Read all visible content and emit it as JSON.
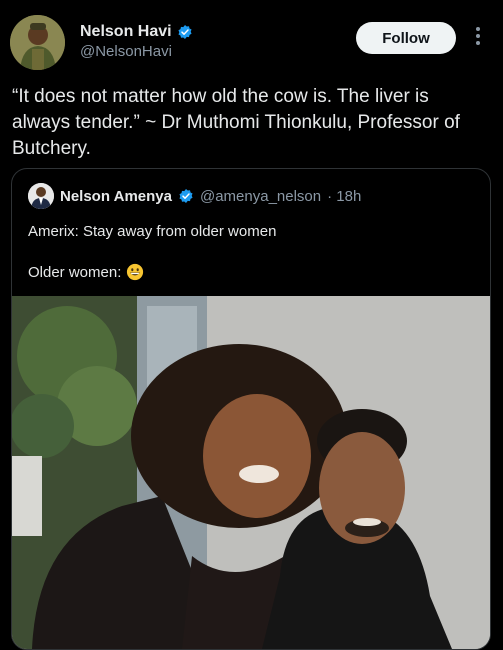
{
  "author": {
    "name": "Nelson Havi",
    "handle": "@NelsonHavi",
    "verified": true,
    "avatar_icon": "person-portrait-avatar"
  },
  "actions": {
    "follow_label": "Follow",
    "more_icon": "vertical-ellipsis-icon"
  },
  "tweet": {
    "text": "“It does not matter how old the cow is. The liver is always tender.” ~ Dr Muthomi Thionkulu, Professor of Butchery."
  },
  "quoted_tweet": {
    "author_name": "Nelson Amenya",
    "author_handle": "@amenya_nelson",
    "time": "· 18h",
    "verified": true,
    "line1": "Amerix: Stay away from older women",
    "line2": "Older women:",
    "emoji": "grinning-face-emoji",
    "media": "selfie-photo"
  },
  "colors": {
    "background": "#000000",
    "text_primary": "#e7e9ea",
    "text_secondary": "#8b98a5",
    "verified_blue": "#1d9bf0",
    "follow_bg": "#eff3f4",
    "border": "#2f3336"
  }
}
